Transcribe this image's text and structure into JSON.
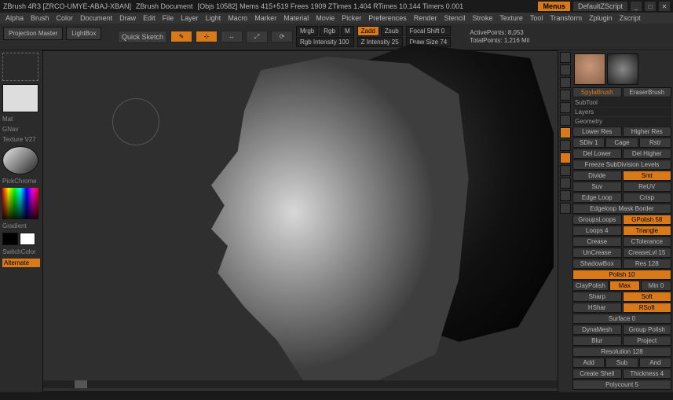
{
  "title": {
    "app": "ZBrush 4R3 [ZRCO-UMYE-ABAJ-XBAN]",
    "doc": "ZBrush Document",
    "objs": "[Objs 10582]  Mems 415+519  Frees 1909  ZTimes 1.404  RTimes 10.144  Timers 0.001",
    "menus": "Menus",
    "defaultz": "DefaultZScript"
  },
  "menubar": [
    "Alpha",
    "Brush",
    "Color",
    "Document",
    "Draw",
    "Edit",
    "File",
    "Layer",
    "Light",
    "Macro",
    "Marker",
    "Material",
    "Movie",
    "Picker",
    "Preferences",
    "Render",
    "Stencil",
    "Stroke",
    "Texture",
    "Tool",
    "Transform",
    "Zplugin",
    "Zscript"
  ],
  "proj": {
    "master": "Projection Master",
    "lightbox": "LightBox"
  },
  "toolbar": {
    "quicksketch": "Quick Sketch",
    "edit": "Edit",
    "draw": "Draw",
    "move": "Move",
    "scale": "Scale",
    "rotate": "Rotate",
    "mrgb": "Mrgb",
    "rgb": "Rgb",
    "m": "M",
    "zadd": "Zadd",
    "zsub": "Zsub",
    "rgbint": "Rgb Intensity 100",
    "zint": "Z Intensity 25",
    "focal": "Focal Shift 0",
    "drawsize": "Draw Size 74",
    "activepoints": "ActivePoints: 8,053",
    "totalpoints": "TotalPoints: 1.216 Mil"
  },
  "left": {
    "mat": "Mat",
    "gnav": "GNav",
    "texture": "Texture V27",
    "pickchrome": "PickChrome",
    "gradient": "Gradient",
    "switchcolor": "SwitchColor",
    "alternate": "Alternate"
  },
  "toolcol": [
    "Edit",
    "Move",
    "Scale",
    "Rotate",
    "Frame",
    "Persp",
    "ActRef",
    "Edit",
    "Local"
  ],
  "right": {
    "spyl": "SpylaBrush",
    "eraser": "EraserBrush",
    "subtool": "SubTool",
    "layers": "Layers",
    "geometry": "Geometry",
    "lowres": "Lower Res",
    "highres": "Higher Res",
    "sdiv": "SDiv 1",
    "cage": "Cage",
    "rstr": "Rstr",
    "dellower": "Del Lower",
    "delhigher": "Del Higher",
    "freeze": "Freeze SubDivision Levels",
    "divide": "Divide",
    "smt": "Smt",
    "suv": "Suv",
    "reuv": "ReUV",
    "edgeloop": "Edge Loop",
    "crisp": "Crisp",
    "edgeloopmask": "Edgeloop Mask Border",
    "loops4": "Loops 4",
    "groupsloops": "GroupsLoops",
    "gpolish": "GPolish 58",
    "triangle": "Triangle",
    "crease": "Crease",
    "ctolerance": "CTolerance",
    "uncrease": "UnCrease",
    "creaselvl": "CreaseLvl 15",
    "shadowbox": "ShadowBox",
    "res128": "Res 128",
    "polish10": "Polish 10",
    "claypolish": "ClayPolish",
    "max": "Max",
    "min0": "Min 0",
    "sharp": "Sharp",
    "soft": "Soft",
    "hshar": "HShar",
    "rsoft": "RSoft",
    "surface": "Surface 0",
    "dynamesh": "DynaMesh",
    "grouppolish": "Group Polish",
    "blur": "Blur",
    "project": "Project",
    "resolution": "Resolution 128",
    "add": "Add",
    "sub": "Sub",
    "and": "And",
    "createshell": "Create Shell",
    "thickness": "Thickness 4",
    "polycount": "Polycount 5"
  }
}
